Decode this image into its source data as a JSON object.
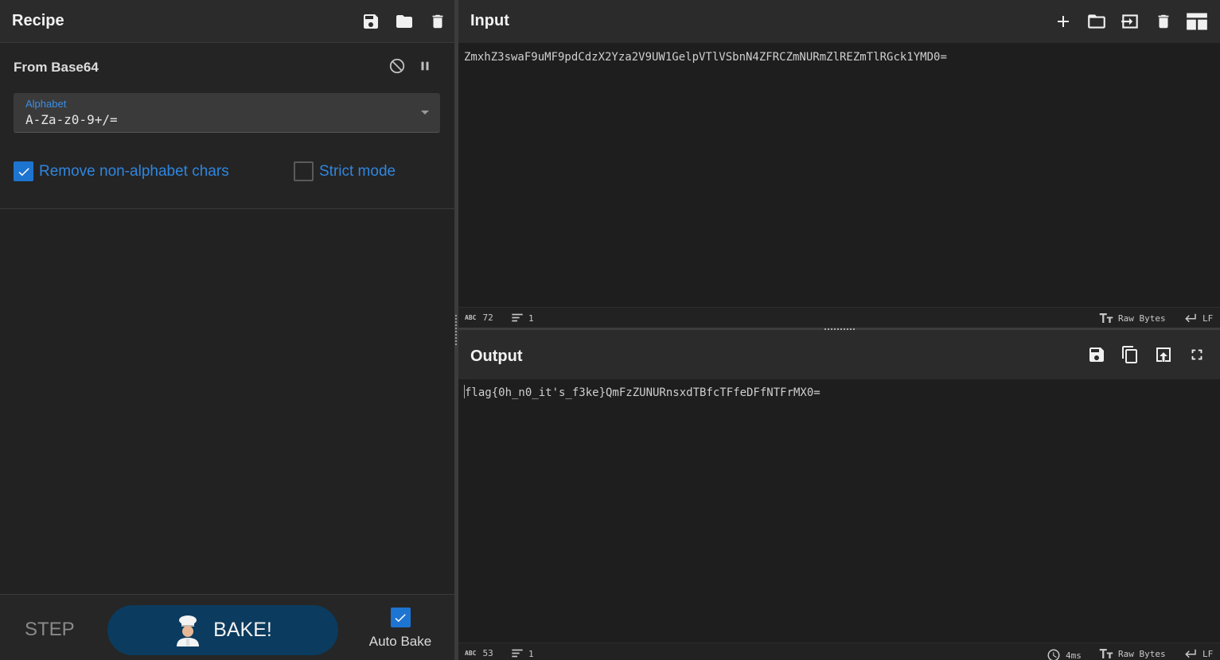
{
  "recipe": {
    "title": "Recipe",
    "header_icons": [
      "save-icon",
      "folder-icon",
      "trash-icon"
    ],
    "operation": {
      "name": "From Base64",
      "alphabet_label": "Alphabet",
      "alphabet_value": "A-Za-z0-9+/=",
      "remove_non_alphabet_label": "Remove non-alphabet chars",
      "remove_non_alphabet_checked": true,
      "strict_mode_label": "Strict mode",
      "strict_mode_checked": false
    },
    "footer": {
      "step_label": "STEP",
      "bake_label": "BAKE!",
      "auto_bake_label": "Auto Bake",
      "auto_bake_checked": true
    }
  },
  "input": {
    "title": "Input",
    "text": "ZmxhZ3swaF9uMF9pdCdzX2Yza2V9UW1GelpVTlVSbnN4ZFRCZmNURmZlREZmTlRGck1YMD0=",
    "status": {
      "length": "72",
      "lines": "1",
      "encoding": "Raw Bytes",
      "eol": "LF"
    },
    "icons": [
      "plus-icon",
      "folder-icon",
      "import-icon",
      "trash-icon",
      "layout-icon"
    ]
  },
  "output": {
    "title": "Output",
    "text": "flag{0h_n0_it's_f3ke}QmFzZUNURnsxdTBfcTFfeDFfNTFrMX0=",
    "status": {
      "length": "53",
      "lines": "1",
      "time": "4ms",
      "encoding": "Raw Bytes",
      "eol": "LF"
    },
    "icons": [
      "save-icon",
      "copy-icon",
      "replace-input-icon",
      "fullscreen-icon"
    ]
  },
  "colors": {
    "accent": "#1e74d1",
    "bake_button": "#0b3b5e",
    "label_blue": "#2f86e0"
  }
}
